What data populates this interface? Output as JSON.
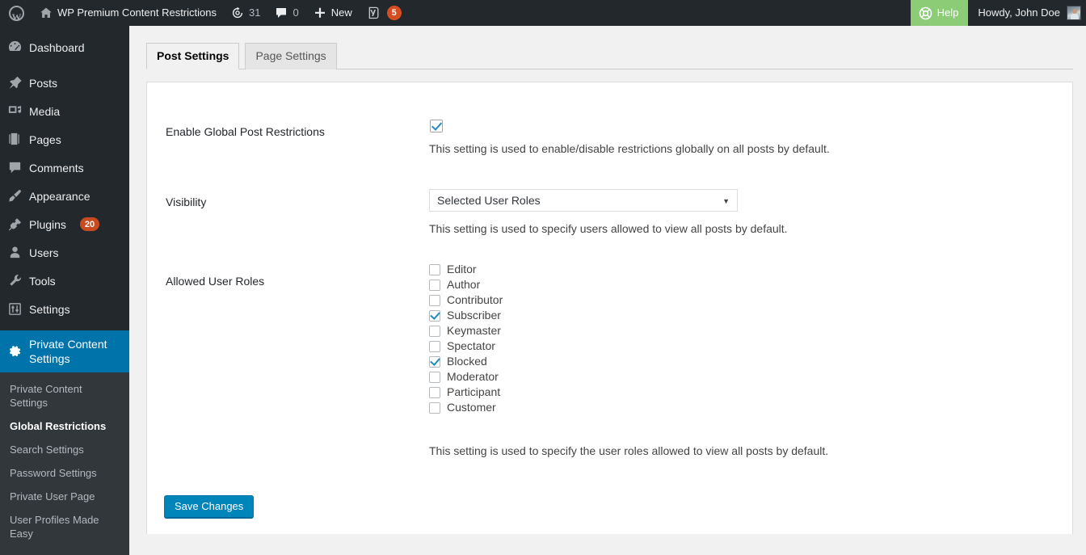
{
  "adminbar": {
    "logo_icon": "wordpress-logo-icon",
    "site_home_icon": "home-icon",
    "site_name": "WP Premium Content Restrictions",
    "updates_icon": "updates-icon",
    "updates_count": "31",
    "comments_icon": "comment-bubble-icon",
    "comments_count": "0",
    "new_icon": "plus-icon",
    "new_label": "New",
    "seo_icon": "yoast-seo-icon",
    "seo_count": "5",
    "help_icon": "help-buoy-icon",
    "help_label": "Help",
    "howdy_label": "Howdy, John Doe",
    "avatar_icon": "user-avatar",
    "help_bg_color": "#8ccc77",
    "bar_bg_color": "#23282d"
  },
  "sidebar": {
    "bg_color": "#23282d",
    "active_color": "#0073aa",
    "submenu_bg_color": "#32373c",
    "items": [
      {
        "label": "Dashboard",
        "icon": "dashboard-icon",
        "badge": ""
      },
      {
        "label": "Posts",
        "icon": "pin-icon",
        "badge": ""
      },
      {
        "label": "Media",
        "icon": "media-icon",
        "badge": ""
      },
      {
        "label": "Pages",
        "icon": "pages-icon",
        "badge": ""
      },
      {
        "label": "Comments",
        "icon": "comment-icon",
        "badge": ""
      },
      {
        "label": "Appearance",
        "icon": "appearance-brush-icon",
        "badge": ""
      },
      {
        "label": "Plugins",
        "icon": "plugin-plug-icon",
        "badge": "20"
      },
      {
        "label": "Users",
        "icon": "user-icon",
        "badge": ""
      },
      {
        "label": "Tools",
        "icon": "tools-wrench-icon",
        "badge": ""
      },
      {
        "label": "Settings",
        "icon": "settings-sliders-icon",
        "badge": ""
      },
      {
        "label": "Private Content Settings",
        "icon": "gear-icon",
        "badge": ""
      }
    ],
    "submenu": [
      {
        "label": "Private Content Settings",
        "current": false
      },
      {
        "label": "Global Restrictions",
        "current": true
      },
      {
        "label": "Search Settings",
        "current": false
      },
      {
        "label": "Password Settings",
        "current": false
      },
      {
        "label": "Private User Page",
        "current": false
      },
      {
        "label": "User Profiles Made Easy",
        "current": false
      }
    ]
  },
  "tabs": [
    {
      "label": "Post Settings",
      "active": true
    },
    {
      "label": "Page Settings",
      "active": false
    }
  ],
  "form": {
    "enable_global": {
      "label": "Enable Global Post Restrictions",
      "checked": true,
      "description": "This setting is used to enable/disable restrictions globally on all posts by default."
    },
    "visibility": {
      "label": "Visibility",
      "value": "Selected User Roles",
      "caret_icon": "chevron-down-icon",
      "description": "This setting is used to specify users allowed to view all posts by default."
    },
    "allowed_roles": {
      "label": "Allowed User Roles",
      "description": "This setting is used to specify the user roles allowed to view all posts by default.",
      "roles": [
        {
          "label": "Editor",
          "checked": false
        },
        {
          "label": "Author",
          "checked": false
        },
        {
          "label": "Contributor",
          "checked": false
        },
        {
          "label": "Subscriber",
          "checked": true
        },
        {
          "label": "Keymaster",
          "checked": false
        },
        {
          "label": "Spectator",
          "checked": false
        },
        {
          "label": "Blocked",
          "checked": true
        },
        {
          "label": "Moderator",
          "checked": false
        },
        {
          "label": "Participant",
          "checked": false
        },
        {
          "label": "Customer",
          "checked": false
        }
      ]
    },
    "save_label": "Save Changes",
    "save_color": "#0085ba"
  }
}
